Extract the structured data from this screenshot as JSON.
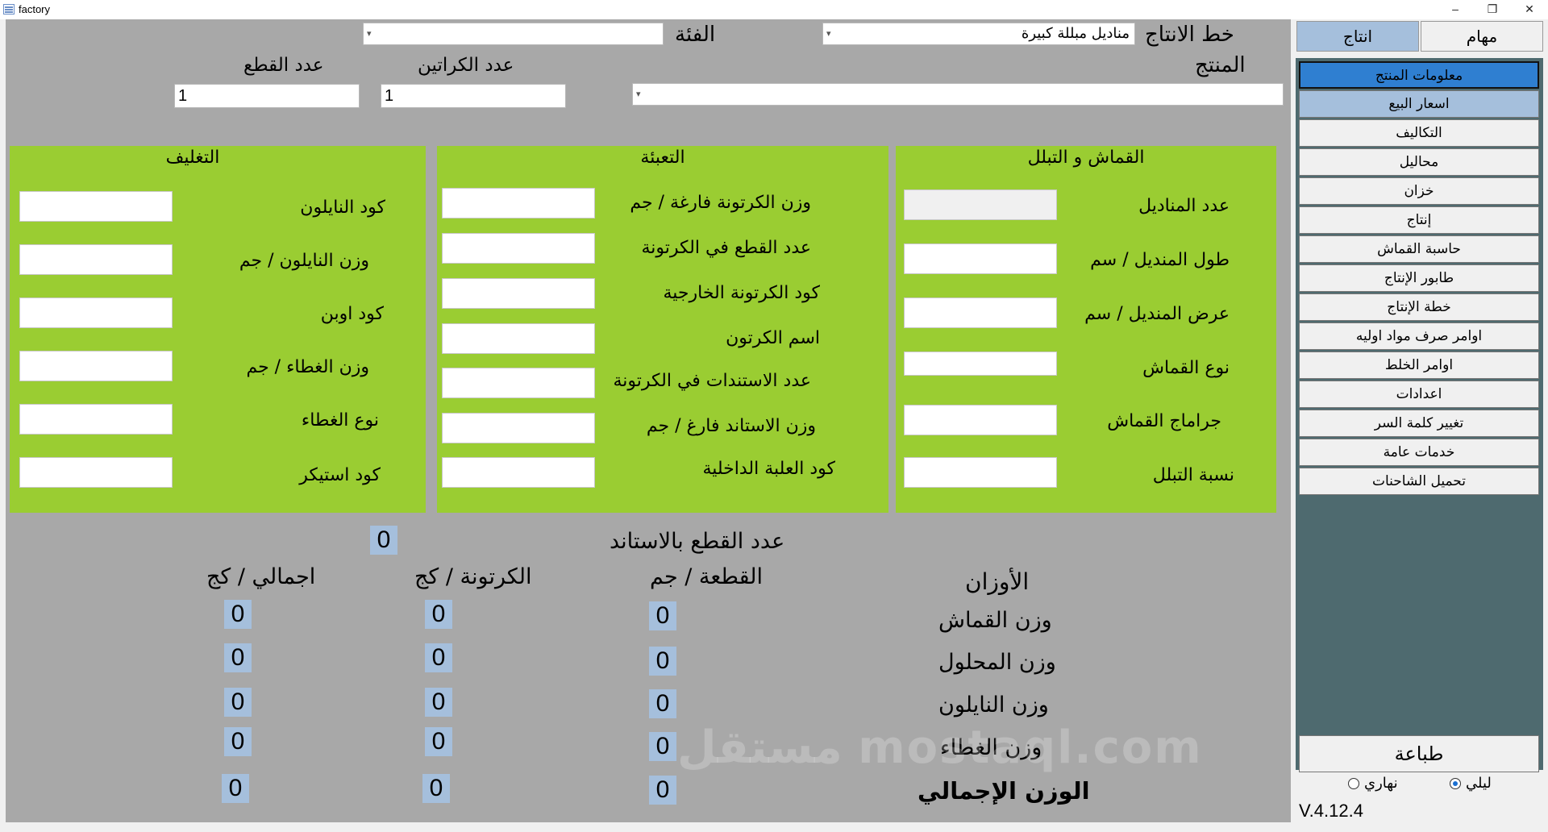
{
  "window": {
    "title": "factory",
    "min": "–",
    "max": "❐",
    "close": "✕"
  },
  "header": {
    "production_line_label": "خط الانتاج",
    "production_line_value": "مناديل مبللة كبيرة",
    "category_label": "الفئة",
    "category_value": "",
    "product_label": "المنتج",
    "product_value": "",
    "cartons_label": "عدد الكراتين",
    "cartons_value": "1",
    "pieces_label": "عدد القطع",
    "pieces_value": "1"
  },
  "panels": {
    "fabric": {
      "title": "القماش و التبلل",
      "fields": [
        "عدد المناديل",
        "طول المنديل / سم",
        "عرض المنديل / سم",
        "نوع القماش",
        "جراماج القماش",
        "نسبة التبلل"
      ]
    },
    "packing": {
      "title": "التعبئة",
      "fields": [
        "وزن الكرتونة فارغة / جم",
        "عدد القطع في الكرتونة",
        "كود الكرتونة الخارجية",
        "اسم الكرتون",
        "عدد الاستندات في الكرتونة",
        "وزن الاستاند فارغ / جم",
        "كود العلبة الداخلية"
      ]
    },
    "wrapping": {
      "title": "التغليف",
      "fields": [
        "كود النايلون",
        "وزن النايلون / جم",
        "كود اوبن",
        "وزن الغطاء / جم",
        "نوع الغطاء",
        "كود استيكر"
      ]
    }
  },
  "weights": {
    "pieces_per_stand_label": "عدد القطع بالاستاند",
    "pieces_per_stand_value": "0",
    "section_label": "الأوزان",
    "col_piece": "القطعة / جم",
    "col_carton": "الكرتونة  / كج",
    "col_total": "اجمالي / كج",
    "rows": [
      {
        "label": "وزن القماش",
        "piece": "0",
        "carton": "0",
        "total": "0"
      },
      {
        "label": "وزن المحلول",
        "piece": "0",
        "carton": "0",
        "total": "0"
      },
      {
        "label": "وزن النايلون",
        "piece": "0",
        "carton": "0",
        "total": "0"
      },
      {
        "label": "وزن الغطاء",
        "piece": "0",
        "carton": "0",
        "total": "0"
      },
      {
        "label": "الوزن الإجمالي",
        "piece": "0",
        "carton": "0",
        "total": "0"
      }
    ]
  },
  "sidebar": {
    "tabs": [
      "مهام",
      "انتاج"
    ],
    "items": [
      "معلومات المنتج",
      "اسعار البيع",
      "التكاليف",
      "محاليل",
      "خزان",
      "إنتاج",
      "حاسبة القماش",
      "طابور الإنتاج",
      "خطة الإنتاج",
      "اوامر صرف مواد اوليه",
      "اوامر الخلط",
      "اعدادات",
      "تغيير كلمة السر",
      "خدمات عامة",
      "تحميل الشاحنات"
    ],
    "print_label": "طباعة",
    "theme_night": "ليلي",
    "theme_day": "نهاري",
    "version": "V.4.12.4"
  },
  "watermark": "مستقل mostaql.com",
  "colors": {
    "panel": "#9acd32",
    "value_bg": "#a5bfdc",
    "selected": "#2f7fd1",
    "sidebar_dark": "#4e6a6f"
  }
}
